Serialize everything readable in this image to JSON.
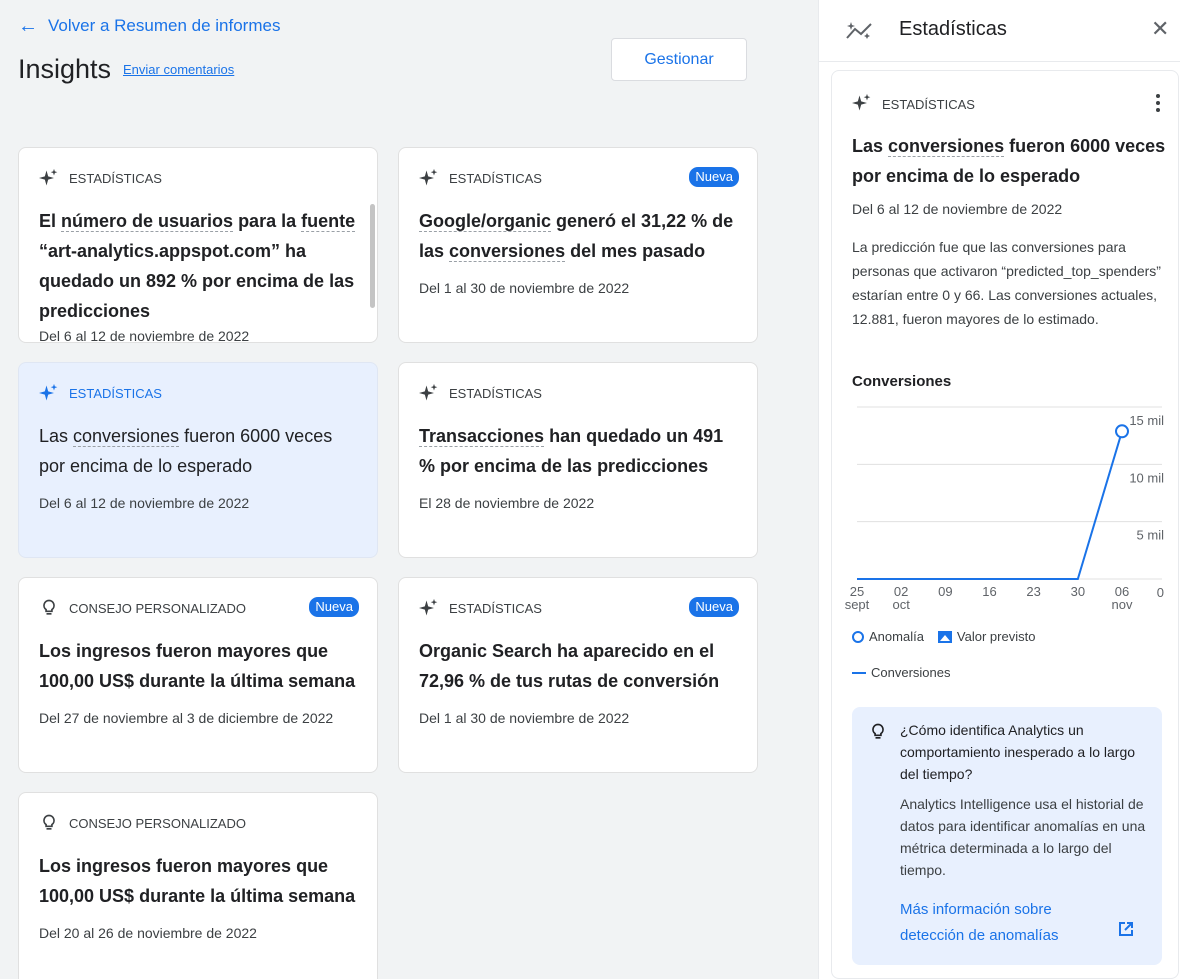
{
  "nav": {
    "back_label": "Volver a Resumen de informes"
  },
  "header": {
    "title": "Insights",
    "feedback_label": "Enviar comentarios",
    "manage_label": "Gestionar"
  },
  "cards": [
    {
      "category": "ESTADÍSTICAS",
      "icon": "sparkle-icon",
      "badge": "",
      "title_parts": [
        "El ",
        "número de usuarios",
        " para la ",
        "fuente",
        " “art-analytics.appspot.com” ha quedado un 892 % por encima de las predicciones"
      ],
      "date": "Del 6 al 12 de noviembre de 2022"
    },
    {
      "category": "ESTADÍSTICAS",
      "icon": "sparkle-icon",
      "badge": "Nueva",
      "title_parts": [
        "",
        "Google/organic",
        " generó el 31,22 % de las ",
        "conversiones",
        " del mes pasado"
      ],
      "date": "Del 1 al 30 de noviembre de 2022"
    },
    {
      "category": "ESTADÍSTICAS",
      "icon": "sparkle-icon",
      "badge": "",
      "selected": true,
      "title_parts": [
        "Las ",
        "conversiones",
        " fueron 6000 veces por encima de lo esperado"
      ],
      "date": "Del 6 al 12 de noviembre de 2022"
    },
    {
      "category": "ESTADÍSTICAS",
      "icon": "sparkle-icon",
      "badge": "",
      "title_parts": [
        "",
        "Transacciones",
        " han quedado un 491 % por encima de las predicciones"
      ],
      "date": "El 28 de noviembre de 2022"
    },
    {
      "category": "CONSEJO PERSONALIZADO",
      "icon": "lightbulb-icon",
      "badge": "Nueva",
      "title_parts": [
        "Los ingresos fueron mayores que 100,00 US$ durante la última semana"
      ],
      "date": "Del 27 de noviembre al 3 de diciembre de 2022"
    },
    {
      "category": "ESTADÍSTICAS",
      "icon": "sparkle-icon",
      "badge": "Nueva",
      "title_parts": [
        "Organic Search ha aparecido en el 72,96 % de tus rutas de conversión"
      ],
      "date": "Del 1 al 30 de noviembre de 2022"
    },
    {
      "category": "CONSEJO PERSONALIZADO",
      "icon": "lightbulb-icon",
      "badge": "",
      "title_parts": [
        "Los ingresos fueron mayores que 100,00 US$ durante la última semana"
      ],
      "date": "Del 20 al 26 de noviembre de 2022"
    }
  ],
  "panel": {
    "title": "Estadísticas",
    "category": "ESTADÍSTICAS",
    "insight_title_parts": [
      "Las ",
      "conversiones",
      " fueron 6000 veces por encima de lo esperado"
    ],
    "date": "Del 6 al 12 de noviembre de 2022",
    "description": "La predicción fue que las conversiones para personas que activaron “predicted_top_spenders” estarían entre 0 y 66. Las conversiones actuales, 12.881, fueron mayores de lo estimado.",
    "chart_title": "Conversiones",
    "legend": {
      "anomaly": "Anomalía",
      "expected": "Valor previsto",
      "series": "Conversiones"
    },
    "info": {
      "question": "¿Cómo identifica Analytics un comportamiento inesperado a lo largo del tiempo?",
      "answer": "Analytics Intelligence usa el historial de datos para identificar anomalías en una métrica determinada a lo largo del tiempo.",
      "link": "Más información sobre detección de anomalías"
    }
  },
  "chart_data": {
    "type": "line",
    "title": "Conversiones",
    "x_tick_labels": [
      [
        "25",
        "sept"
      ],
      [
        "02",
        "oct"
      ],
      [
        "09",
        ""
      ],
      [
        "16",
        ""
      ],
      [
        "23",
        ""
      ],
      [
        "30",
        ""
      ],
      [
        "06",
        "nov"
      ]
    ],
    "y_tick_labels": [
      "15 mil",
      "10 mil",
      "5 mil",
      "0"
    ],
    "y_ticks": [
      15000,
      10000,
      5000,
      0
    ],
    "ylim": [
      0,
      15000
    ],
    "series": [
      {
        "name": "Conversiones",
        "x": [
          "2022-09-25",
          "2022-10-02",
          "2022-10-09",
          "2022-10-16",
          "2022-10-23",
          "2022-10-30",
          "2022-11-06"
        ],
        "values": [
          0,
          0,
          0,
          0,
          0,
          0,
          12881
        ]
      }
    ],
    "anomaly": {
      "x": "2022-11-06",
      "y": 12881
    },
    "colors": {
      "line": "#1a73e8",
      "grid": "#e0e0e0"
    },
    "grid": true,
    "legend_position": "bottom"
  }
}
